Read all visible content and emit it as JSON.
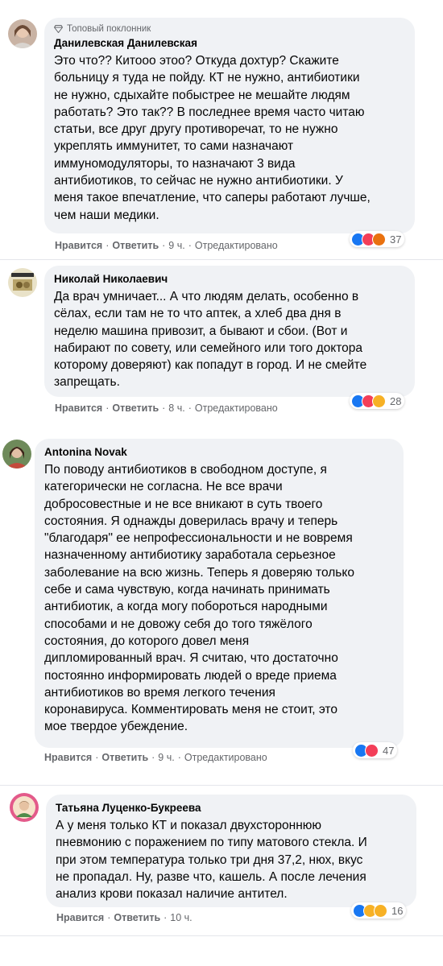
{
  "comments": [
    {
      "badge": "Топовый поклонник",
      "name": "Данилевская Данилевская",
      "text": "Это что?? Китооо этоо? Откуда дохтур? Скажите\nбольницу я туда не пойду. КТ не нужно, антибиотики\nне нужно, сдыхайте побыстрее не мешайте людям\nработать? Это так?? В последнее время часто читаю\nстатьи, все друг другу противоречат, то не нужно\nукреплять иммунитет, то сами назначают\nиммуномодуляторы, то назначают 3 вида\nантибиотиков, то сейчас не нужно антибиотики. У\nменя такое впечатление, что саперы работают лучше,\nчем наши медики.",
      "like": "Нравится",
      "reply": "Ответить",
      "time": "9 ч.",
      "edited": "Отредактировано",
      "reaction_icons": [
        "like-icon",
        "love-icon",
        "angry-icon"
      ],
      "reaction_count": "37"
    },
    {
      "name": "Николай Николаевич",
      "text": "Да врач умничает... А что людям делать, особенно в\nсёлах, если там не то что аптек, а хлеб два дня в\nнеделю машина привозит, а бывают и сбои. (Вот и\nнабирают по совету, или семейного или того доктора\nкоторому доверяют) как попадут в город. И не смейте\nзапрещать.",
      "like": "Нравится",
      "reply": "Ответить",
      "time": "8 ч.",
      "edited": "Отредактировано",
      "reaction_icons": [
        "like-icon",
        "love-icon",
        "haha-icon"
      ],
      "reaction_count": "28"
    },
    {
      "name": "Antonina Novak",
      "text": "По поводу антибиотиков в свободном доступе, я\nкатегорически не согласна. Не все врачи\nдобросовестные и не все вникают в суть твоего\nсостояния. Я однажды доверилась врачу и теперь\n\"благодаря\" ее непрофессиональности и не вовремя\nназначенному антибиотику заработала серьезное\nзаболевание на всю жизнь. Теперь я доверяю только\nсебе и сама чувствую, когда начинать принимать\nантибиотик, а когда могу побороться народными\nспособами и не довожу себя до того тяжёлого\nсостояния, до которого довел меня\nдипломированный врач. Я считаю, что достаточно\nпостоянно информировать людей о вреде приема\nантибиотиков во время легкого течения\nкоронавируса. Комментировать меня не стоит, это\nмое твердое убеждение.",
      "like": "Нравится",
      "reply": "Ответить",
      "time": "9 ч.",
      "edited": "Отредактировано",
      "reaction_icons": [
        "like-icon",
        "love-icon"
      ],
      "reaction_count": "47"
    },
    {
      "name": "Татьяна Луценко-Букреева",
      "text": "А у меня только КТ и показал двухстороннюю\nпневмонию с поражением по типу матового стекла. И\nпри этом температура только три дня 37,2, нюх, вкус\nне пропадал. Ну, разве что, кашель. А после лечения\nанализ крови показал наличие антител.",
      "like": "Нравится",
      "reply": "Ответить",
      "time": "10 ч.",
      "reaction_icons": [
        "like-icon",
        "wow-icon",
        "sad-icon"
      ],
      "reaction_count": "16"
    }
  ],
  "colors": {
    "bubble": "#f0f2f5",
    "meta_text": "#65676b",
    "like_blue": "#1877f2",
    "love_red": "#f33e58",
    "angry_orange": "#e9710f",
    "emoji_yellow": "#f7b125"
  }
}
